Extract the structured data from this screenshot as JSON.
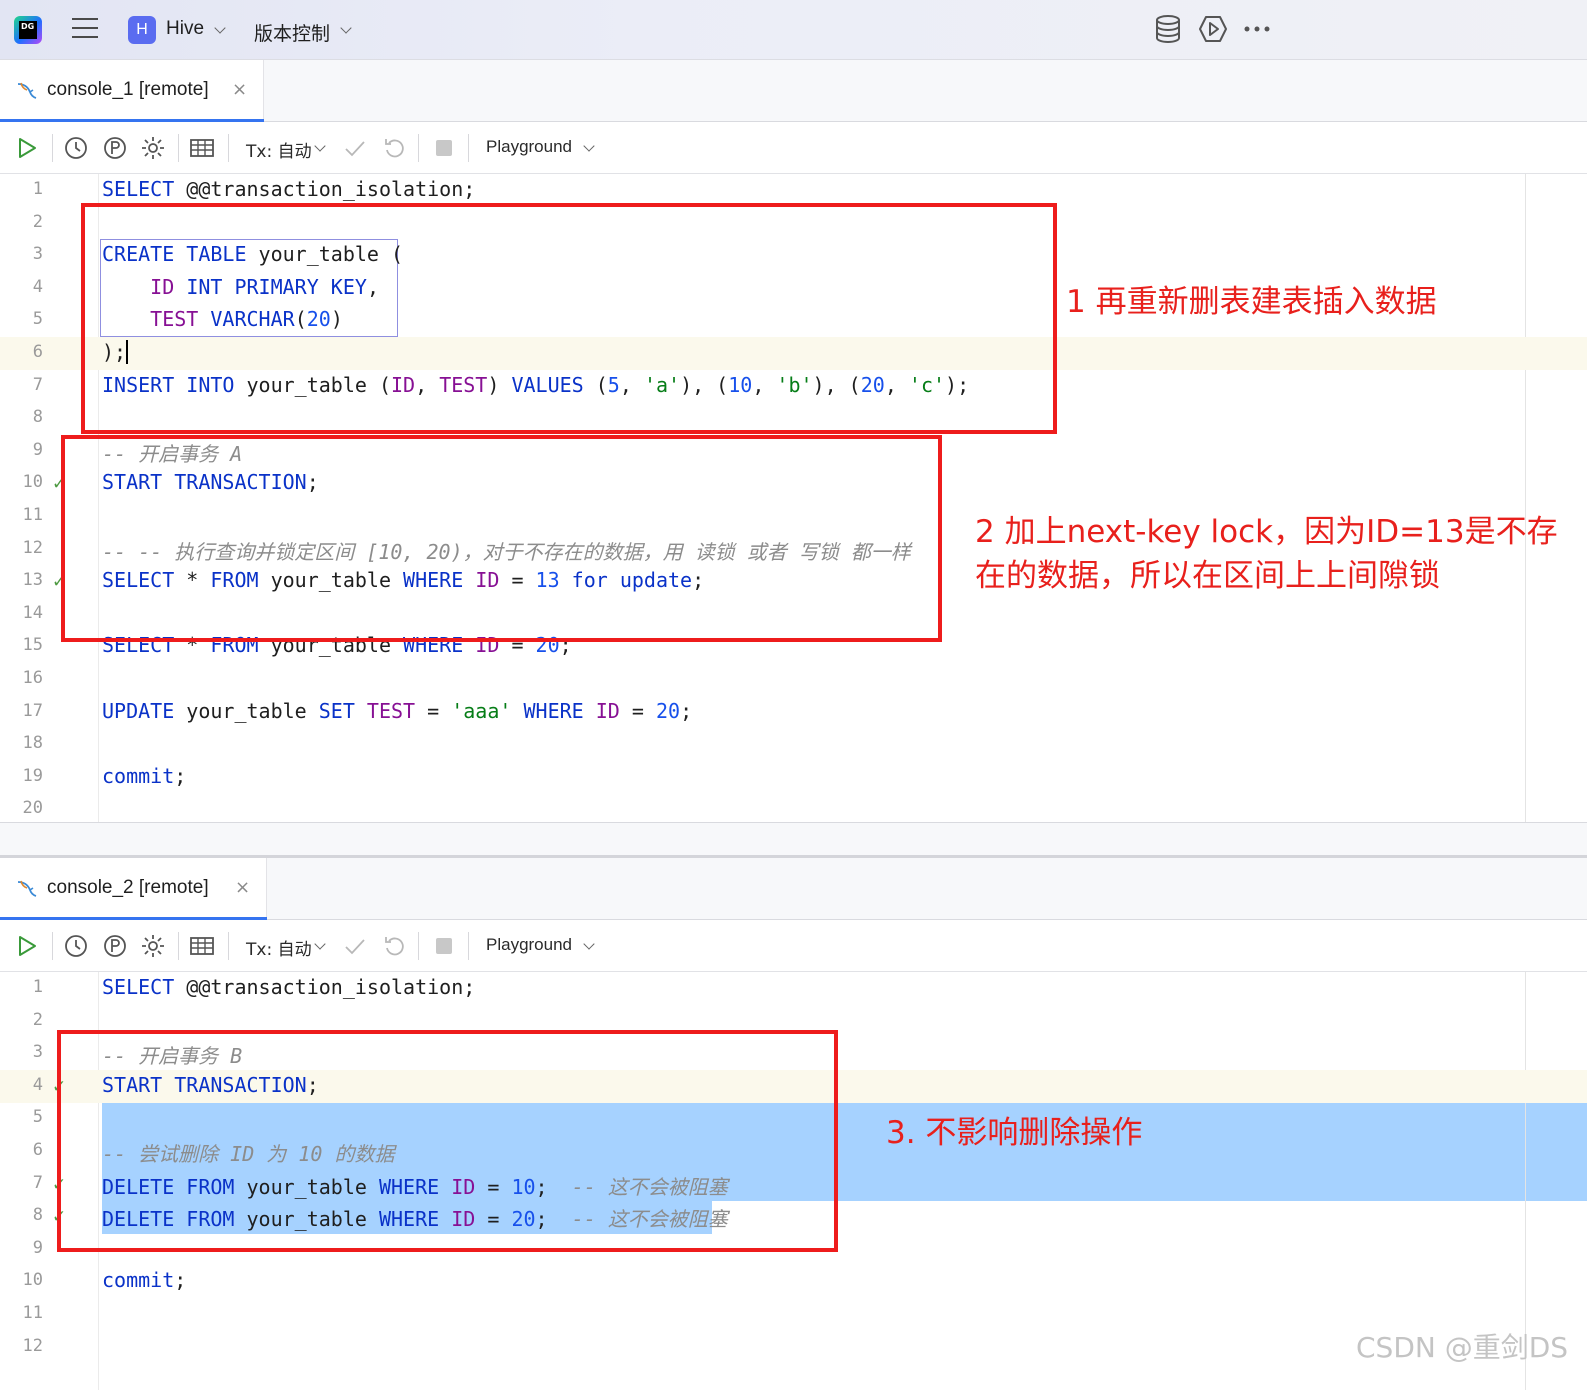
{
  "titlebar": {
    "app_logo_text": "DG",
    "project_badge": "H",
    "project_name": "Hive",
    "vcs_menu": "版本控制"
  },
  "console1": {
    "tab_label": "console_1 [remote]",
    "close_glyph": "×",
    "toolbar": {
      "tx_label": "Tx: 自动",
      "playground_label": "Playground"
    }
  },
  "console2": {
    "tab_label": "console_2 [remote]",
    "close_glyph": "×",
    "toolbar": {
      "tx_label": "Tx: 自动",
      "playground_label": "Playground"
    }
  },
  "editor1": {
    "line_numbers": [
      "1",
      "2",
      "3",
      "4",
      "5",
      "6",
      "7",
      "8",
      "9",
      "10",
      "11",
      "12",
      "13",
      "14",
      "15",
      "16",
      "17",
      "18",
      "19",
      "20"
    ],
    "lines": [
      [
        [
          "kw",
          "SELECT"
        ],
        [
          "op",
          " @@transaction_isolation;"
        ]
      ],
      [],
      [
        [
          "kw",
          "CREATE TABLE"
        ],
        [
          "op",
          " your_table ("
        ]
      ],
      [
        [
          "op",
          "    "
        ],
        [
          "id",
          "ID"
        ],
        [
          "op",
          " "
        ],
        [
          "kw",
          "INT PRIMARY KEY"
        ],
        [
          "op",
          ","
        ]
      ],
      [
        [
          "op",
          "    "
        ],
        [
          "id",
          "TEST"
        ],
        [
          "op",
          " "
        ],
        [
          "kw",
          "VARCHAR"
        ],
        [
          "op",
          "("
        ],
        [
          "num",
          "20"
        ],
        [
          "op",
          ")"
        ]
      ],
      [
        [
          "op",
          ");"
        ]
      ],
      [
        [
          "kw",
          "INSERT INTO"
        ],
        [
          "op",
          " your_table ("
        ],
        [
          "id",
          "ID"
        ],
        [
          "op",
          ", "
        ],
        [
          "id",
          "TEST"
        ],
        [
          "op",
          ") "
        ],
        [
          "kw",
          "VALUES"
        ],
        [
          "op",
          " ("
        ],
        [
          "num",
          "5"
        ],
        [
          "op",
          ", "
        ],
        [
          "str",
          "'a'"
        ],
        [
          "op",
          "), ("
        ],
        [
          "num",
          "10"
        ],
        [
          "op",
          ", "
        ],
        [
          "str",
          "'b'"
        ],
        [
          "op",
          "), ("
        ],
        [
          "num",
          "20"
        ],
        [
          "op",
          ", "
        ],
        [
          "str",
          "'c'"
        ],
        [
          "op",
          ");"
        ]
      ],
      [],
      [
        [
          "cm",
          "-- 开启事务 A"
        ]
      ],
      [
        [
          "kw",
          "START TRANSACTION"
        ],
        [
          "op",
          ";"
        ]
      ],
      [],
      [
        [
          "cm",
          "-- -- 执行查询并锁定区间 [10, 20)，对于不存在的数据，用 读锁 或者 写锁 都一样"
        ]
      ],
      [
        [
          "kw",
          "SELECT"
        ],
        [
          "op",
          " * "
        ],
        [
          "kw",
          "FROM"
        ],
        [
          "op",
          " your_table "
        ],
        [
          "kw",
          "WHERE"
        ],
        [
          "op",
          " "
        ],
        [
          "id",
          "ID"
        ],
        [
          "op",
          " = "
        ],
        [
          "num",
          "13"
        ],
        [
          "op",
          " "
        ],
        [
          "kw",
          "for update"
        ],
        [
          "op",
          ";"
        ]
      ],
      [],
      [
        [
          "kw",
          "SELECT"
        ],
        [
          "op",
          " * "
        ],
        [
          "kw",
          "FROM"
        ],
        [
          "op",
          " your_table "
        ],
        [
          "kw",
          "WHERE"
        ],
        [
          "op",
          " "
        ],
        [
          "id",
          "ID"
        ],
        [
          "op",
          " = "
        ],
        [
          "num",
          "20"
        ],
        [
          "op",
          ";"
        ]
      ],
      [],
      [
        [
          "kw",
          "UPDATE"
        ],
        [
          "op",
          " your_table "
        ],
        [
          "kw",
          "SET"
        ],
        [
          "op",
          " "
        ],
        [
          "id",
          "TEST"
        ],
        [
          "op",
          " = "
        ],
        [
          "str",
          "'aaa'"
        ],
        [
          "op",
          " "
        ],
        [
          "kw",
          "WHERE"
        ],
        [
          "op",
          " "
        ],
        [
          "id",
          "ID"
        ],
        [
          "op",
          " = "
        ],
        [
          "num",
          "20"
        ],
        [
          "op",
          ";"
        ]
      ],
      [],
      [
        [
          "kw",
          "commit"
        ],
        [
          "op",
          ";"
        ]
      ],
      []
    ]
  },
  "editor2": {
    "line_numbers": [
      "1",
      "2",
      "3",
      "4",
      "5",
      "6",
      "7",
      "8",
      "9",
      "10",
      "11",
      "12"
    ],
    "lines": [
      [
        [
          "kw",
          "SELECT"
        ],
        [
          "op",
          " @@transaction_isolation;"
        ]
      ],
      [],
      [
        [
          "cm",
          "-- 开启事务 B"
        ]
      ],
      [
        [
          "kw",
          "START TRANSACTION"
        ],
        [
          "op",
          ";"
        ]
      ],
      [],
      [
        [
          "cm",
          "-- 尝试删除 ID 为 10 的数据"
        ]
      ],
      [
        [
          "kw",
          "DELETE FROM"
        ],
        [
          "op",
          " your_table "
        ],
        [
          "kw",
          "WHERE"
        ],
        [
          "op",
          " "
        ],
        [
          "id",
          "ID"
        ],
        [
          "op",
          " = "
        ],
        [
          "num",
          "10"
        ],
        [
          "op",
          ";  "
        ],
        [
          "cm",
          "-- 这不会被阻塞"
        ]
      ],
      [
        [
          "kw",
          "DELETE FROM"
        ],
        [
          "op",
          " your_table "
        ],
        [
          "kw",
          "WHERE"
        ],
        [
          "op",
          " "
        ],
        [
          "id",
          "ID"
        ],
        [
          "op",
          " = "
        ],
        [
          "num",
          "20"
        ],
        [
          "op",
          ";  "
        ],
        [
          "cm",
          "-- 这不会被阻塞"
        ]
      ],
      [],
      [
        [
          "kw",
          "commit"
        ],
        [
          "op",
          ";"
        ]
      ],
      [],
      []
    ]
  },
  "annotations": {
    "note1": "1 再重新删表建表插入数据",
    "note2_line1": "2 加上next-key lock，因为ID=13是不存",
    "note2_line2": "在的数据，所以在区间上上间隙锁",
    "note3": "3. 不影响删除操作"
  },
  "watermark": "CSDN @重剑DS",
  "colors": {
    "accent": "#3574f0",
    "annotation_red": "#ee1c1c",
    "selection": "#a6d2ff",
    "keyword": "#0a32c8",
    "identifier": "#871094",
    "number": "#1750eb",
    "string": "#067d17",
    "success_check": "#4e9a42"
  }
}
